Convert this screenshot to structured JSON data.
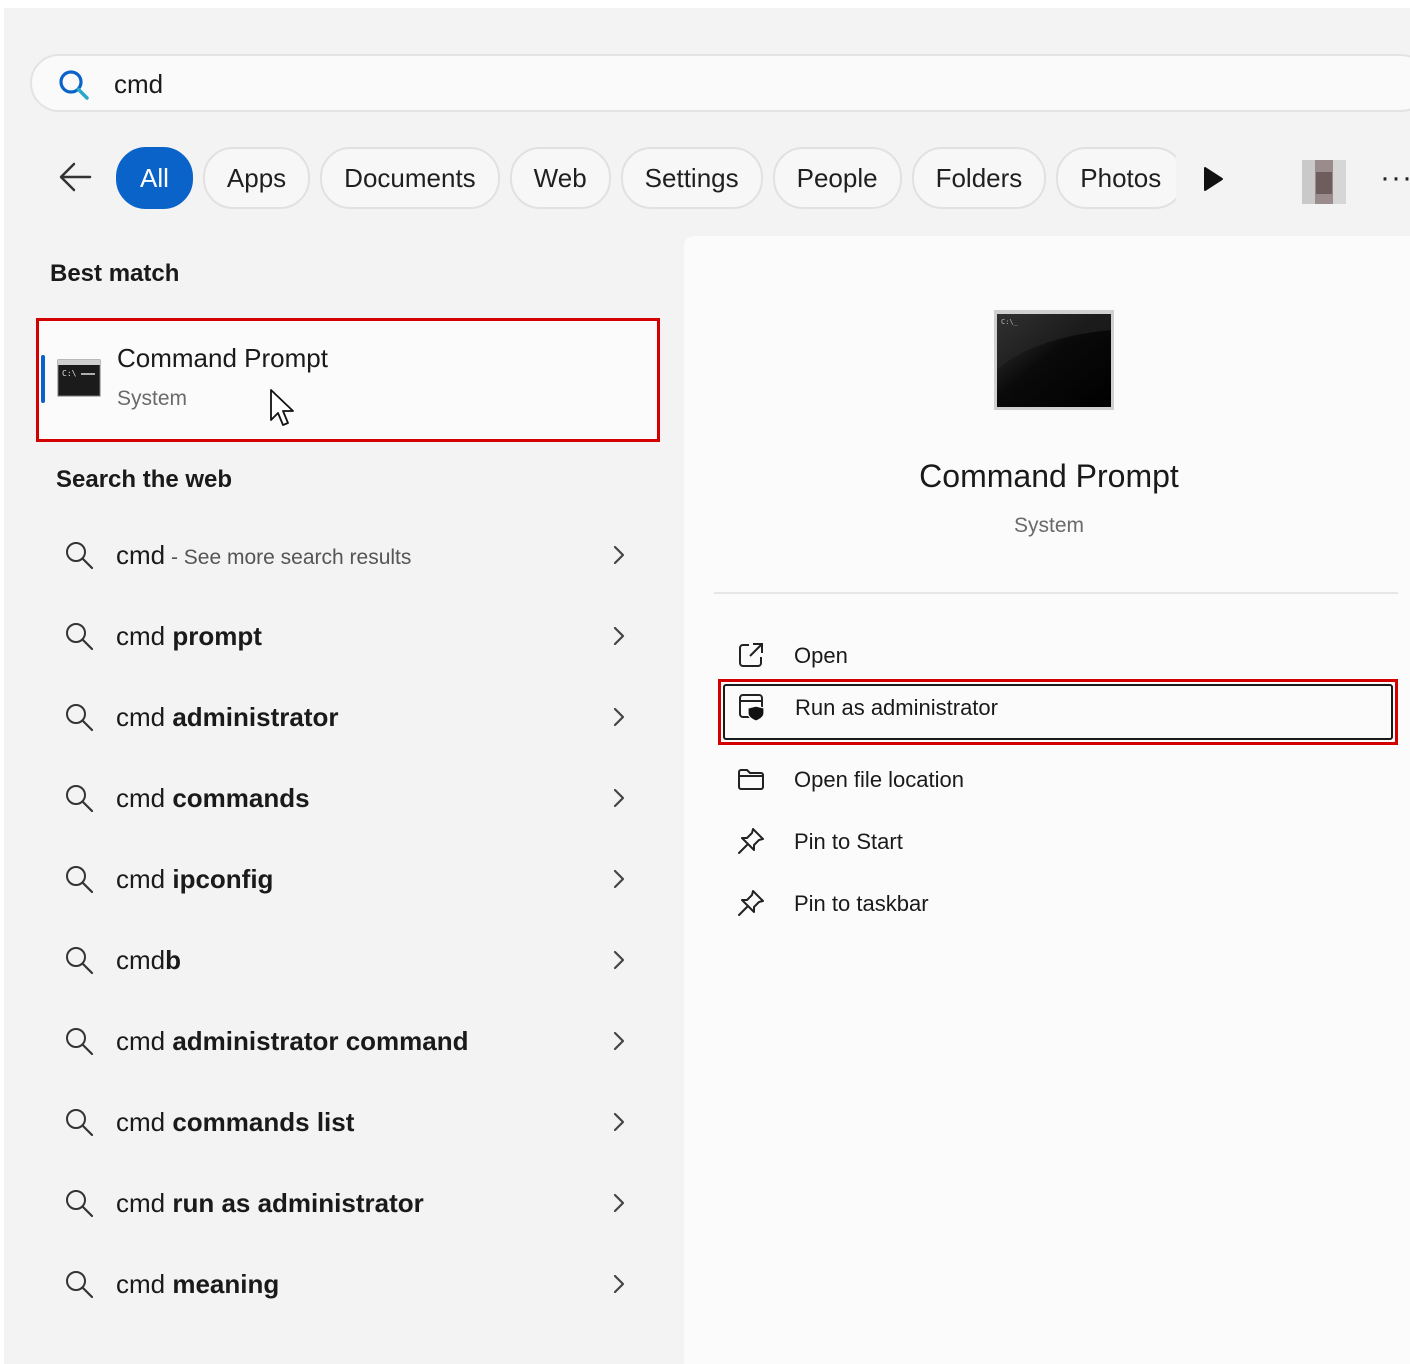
{
  "search": {
    "value": "cmd"
  },
  "filters": {
    "tabs": [
      {
        "label": "All",
        "active": true
      },
      {
        "label": "Apps"
      },
      {
        "label": "Documents"
      },
      {
        "label": "Web"
      },
      {
        "label": "Settings"
      },
      {
        "label": "People"
      },
      {
        "label": "Folders"
      },
      {
        "label": "Photos"
      }
    ],
    "more": "···"
  },
  "best_match": {
    "heading": "Best match",
    "title": "Command Prompt",
    "subtitle": "System"
  },
  "web": {
    "heading": "Search the web",
    "items": [
      {
        "prefix": "cmd",
        "bold": "",
        "hint": " - See more search results"
      },
      {
        "prefix": "cmd ",
        "bold": "prompt",
        "hint": ""
      },
      {
        "prefix": "cmd ",
        "bold": "administrator",
        "hint": ""
      },
      {
        "prefix": "cmd ",
        "bold": "commands",
        "hint": ""
      },
      {
        "prefix": "cmd ",
        "bold": "ipconfig",
        "hint": ""
      },
      {
        "prefix": "cmd",
        "bold": "b",
        "hint": ""
      },
      {
        "prefix": "cmd ",
        "bold": "administrator command",
        "hint": ""
      },
      {
        "prefix": "cmd ",
        "bold": "commands list",
        "hint": ""
      },
      {
        "prefix": "cmd ",
        "bold": "run as administrator",
        "hint": ""
      },
      {
        "prefix": "cmd ",
        "bold": "meaning",
        "hint": ""
      }
    ]
  },
  "detail": {
    "title": "Command Prompt",
    "subtitle": "System",
    "actions": [
      {
        "label": "Open",
        "icon": "open-external-icon"
      },
      {
        "label": "Run as administrator",
        "icon": "shield-window-icon"
      },
      {
        "label": "Open file location",
        "icon": "folder-icon"
      },
      {
        "label": "Pin to Start",
        "icon": "pin-icon"
      },
      {
        "label": "Pin to taskbar",
        "icon": "pin-icon"
      }
    ]
  },
  "colors": {
    "accent": "#0a63c9",
    "highlight_box": "#d40000",
    "panel": "#f3f3f3"
  }
}
